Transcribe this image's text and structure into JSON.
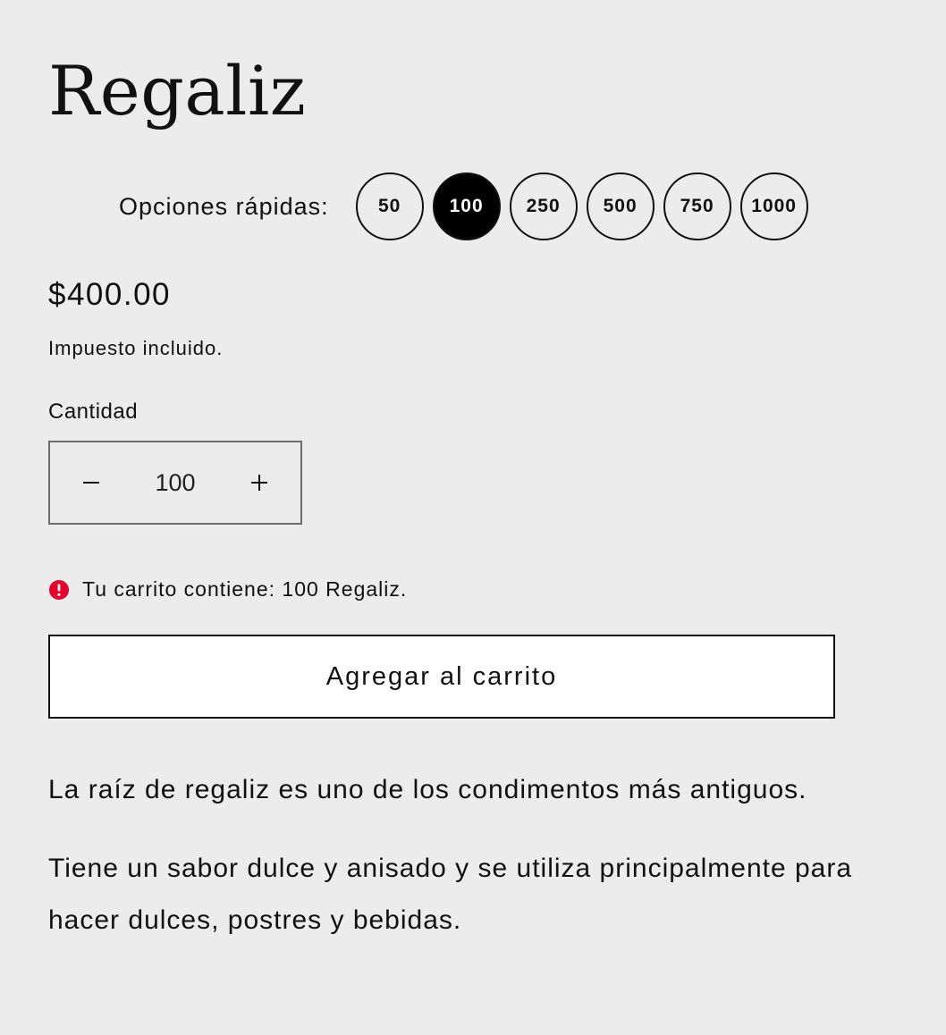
{
  "product": {
    "title": "Regaliz",
    "price": "$400.00",
    "tax_note": "Impuesto incluido."
  },
  "quick_options": {
    "label": "Opciones rápidas:",
    "options": [
      "50",
      "100",
      "250",
      "500",
      "750",
      "1000"
    ],
    "selected": "100"
  },
  "quantity": {
    "label": "Cantidad",
    "value": "100",
    "decrease_icon": "minus-icon",
    "increase_icon": "plus-icon"
  },
  "cart_notice": {
    "icon": "alert-circle-icon",
    "icon_color": "#e4002b",
    "text": "Tu carrito contiene: 100 Regaliz."
  },
  "add_to_cart": {
    "label": "Agregar al carrito"
  },
  "description": {
    "paragraphs": [
      "La raíz de regaliz es uno de los condimentos más antiguos.",
      "Tiene un sabor dulce y anisado y se utiliza principalmente para hacer dulces, postres y bebidas."
    ]
  },
  "colors": {
    "background": "#ececec",
    "text": "#111111",
    "selected_option_bg": "#000000",
    "button_bg": "#ffffff"
  }
}
